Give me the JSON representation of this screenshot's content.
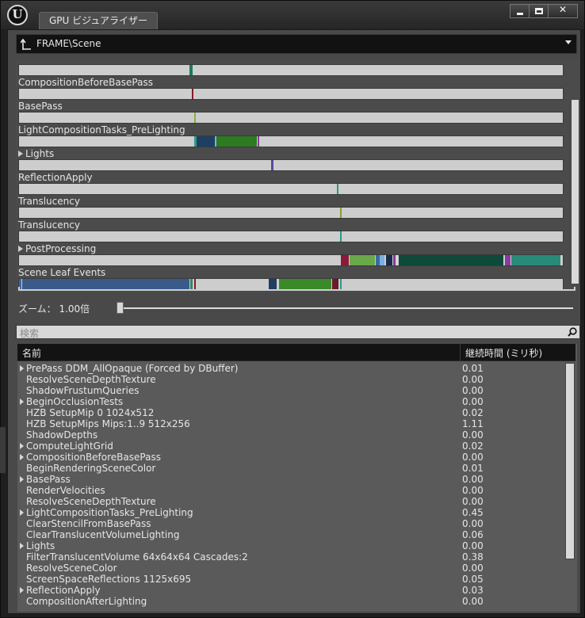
{
  "window": {
    "logo_text": "U",
    "tab_title": "GPU ビジュアライザー",
    "buttons": {
      "minimize": "",
      "maximize": "",
      "close": "✕"
    }
  },
  "breadcrumb": {
    "path": "FRAME\\Scene"
  },
  "timeline": {
    "rows": [
      {
        "label": "",
        "collapsible": false,
        "segments": [
          {
            "start": 0.3135,
            "end": 0.3195,
            "color": "#1e7a5a"
          }
        ]
      },
      {
        "label": "CompositionBeforeBasePass",
        "collapsible": false,
        "segments": [
          {
            "start": 0.3175,
            "end": 0.321,
            "color": "#8a1a2a"
          }
        ]
      },
      {
        "label": "BasePass",
        "collapsible": false,
        "segments": [
          {
            "start": 0.3215,
            "end": 0.3245,
            "color": "#8ab43a"
          }
        ]
      },
      {
        "label": "LightCompositionTasks_PreLighting",
        "collapsible": false,
        "segments": [
          {
            "start": 0.3215,
            "end": 0.3255,
            "color": "#2f9a8a"
          },
          {
            "start": 0.3265,
            "end": 0.3595,
            "color": "#1f3f62"
          },
          {
            "start": 0.3605,
            "end": 0.3625,
            "color": "#7ab0e0"
          },
          {
            "start": 0.3635,
            "end": 0.4385,
            "color": "#2e7a20"
          },
          {
            "start": 0.4395,
            "end": 0.4425,
            "color": "#8a3aa0"
          }
        ]
      },
      {
        "label": "Lights",
        "collapsible": true,
        "segments": [
          {
            "start": 0.4635,
            "end": 0.4675,
            "color": "#5a4aa0"
          }
        ]
      },
      {
        "label": "ReflectionApply",
        "collapsible": false,
        "segments": [
          {
            "start": 0.5845,
            "end": 0.5875,
            "color": "#2a9a8a"
          }
        ]
      },
      {
        "label": "Translucency",
        "collapsible": false,
        "segments": [
          {
            "start": 0.5905,
            "end": 0.5935,
            "color": "#8a9a3a"
          }
        ]
      },
      {
        "label": "Translucency",
        "collapsible": false,
        "segments": [
          {
            "start": 0.5905,
            "end": 0.5935,
            "color": "#2a9a8a"
          }
        ]
      },
      {
        "label": "PostProcessing",
        "collapsible": true,
        "segments": [
          {
            "start": 0.5915,
            "end": 0.6065,
            "color": "#8a1a3a"
          },
          {
            "start": 0.6075,
            "end": 0.6535,
            "color": "#6aa84a"
          },
          {
            "start": 0.6555,
            "end": 0.6625,
            "color": "#3a6aa0"
          },
          {
            "start": 0.6635,
            "end": 0.6725,
            "color": "#7ab0e0"
          },
          {
            "start": 0.6745,
            "end": 0.6865,
            "color": "#1a2a4a"
          },
          {
            "start": 0.6875,
            "end": 0.6915,
            "color": "#8a3aa0"
          },
          {
            "start": 0.6935,
            "end": 0.6965,
            "color": "#d8d8d8"
          },
          {
            "start": 0.6985,
            "end": 0.8915,
            "color": "#0e4a3a"
          },
          {
            "start": 0.8935,
            "end": 0.9035,
            "color": "#8a3aa0"
          },
          {
            "start": 0.9055,
            "end": 0.9965,
            "color": "#2a8a7a"
          }
        ]
      },
      {
        "label": "Scene Leaf Events",
        "collapsible": false,
        "segments": [
          {
            "start": 0.0,
            "end": 0.004,
            "color": "#3a6aa0"
          },
          {
            "start": 0.006,
            "end": 0.3135,
            "color": "#3a5a8a"
          },
          {
            "start": 0.3145,
            "end": 0.3195,
            "color": "#2a8a6a"
          },
          {
            "start": 0.3215,
            "end": 0.3245,
            "color": "#8a1a2a"
          },
          {
            "start": 0.4595,
            "end": 0.4745,
            "color": "#1f3f62"
          },
          {
            "start": 0.4775,
            "end": 0.5735,
            "color": "#3a8a2a"
          },
          {
            "start": 0.5755,
            "end": 0.5865,
            "color": "#6a1a2a"
          },
          {
            "start": 0.5905,
            "end": 0.5935,
            "color": "#2a9a8a"
          }
        ]
      }
    ]
  },
  "zoom": {
    "label": "ズーム： 1.00倍",
    "value": 1.0
  },
  "search": {
    "placeholder": "検索"
  },
  "table": {
    "columns": {
      "name": "名前",
      "duration": "継続時間 (ミリ秒)"
    },
    "rows": [
      {
        "name": "PrePass DDM_AllOpaque (Forced by DBuffer)",
        "duration": "0.01",
        "children": true
      },
      {
        "name": "ResolveSceneDepthTexture",
        "duration": "0.00",
        "children": false
      },
      {
        "name": "ShadowFrustumQueries",
        "duration": "0.00",
        "children": false
      },
      {
        "name": "BeginOcclusionTests",
        "duration": "0.00",
        "children": true
      },
      {
        "name": "HZB SetupMip 0 1024x512",
        "duration": "0.02",
        "children": false
      },
      {
        "name": "HZB SetupMips Mips:1..9 512x256",
        "duration": "1.11",
        "children": false
      },
      {
        "name": "ShadowDepths",
        "duration": "0.00",
        "children": false
      },
      {
        "name": "ComputeLightGrid",
        "duration": "0.02",
        "children": true
      },
      {
        "name": "CompositionBeforeBasePass",
        "duration": "0.00",
        "children": true
      },
      {
        "name": "BeginRenderingSceneColor",
        "duration": "0.01",
        "children": false
      },
      {
        "name": "BasePass",
        "duration": "0.00",
        "children": true
      },
      {
        "name": "RenderVelocities",
        "duration": "0.00",
        "children": false
      },
      {
        "name": "ResolveSceneDepthTexture",
        "duration": "0.00",
        "children": false
      },
      {
        "name": "LightCompositionTasks_PreLighting",
        "duration": "0.45",
        "children": true
      },
      {
        "name": "ClearStencilFromBasePass",
        "duration": "0.00",
        "children": false
      },
      {
        "name": "ClearTranslucentVolumeLighting",
        "duration": "0.06",
        "children": false
      },
      {
        "name": "Lights",
        "duration": "0.00",
        "children": true
      },
      {
        "name": "FilterTranslucentVolume 64x64x64 Cascades:2",
        "duration": "0.38",
        "children": false
      },
      {
        "name": "ResolveSceneColor",
        "duration": "0.00",
        "children": false
      },
      {
        "name": "ScreenSpaceReflections 1125x695",
        "duration": "0.05",
        "children": false
      },
      {
        "name": "ReflectionApply",
        "duration": "0.03",
        "children": true
      },
      {
        "name": "CompositionAfterLighting",
        "duration": "0.00",
        "children": false
      }
    ]
  }
}
